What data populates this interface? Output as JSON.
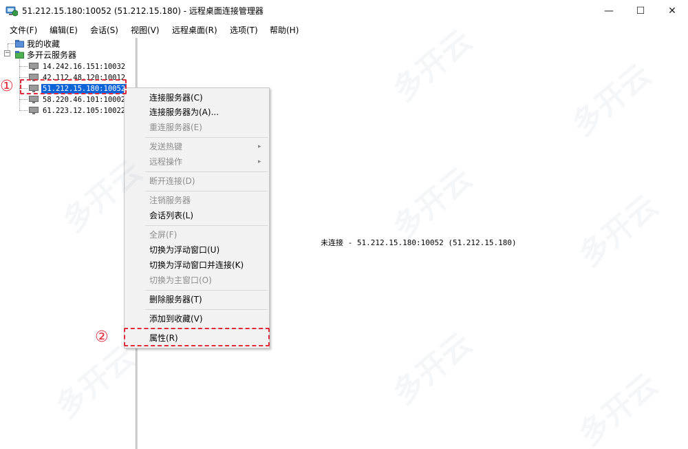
{
  "window": {
    "title": "51.212.15.180:10052 (51.212.15.180) - 远程桌面连接管理器",
    "min_glyph": "—",
    "max_glyph": "☐",
    "close_glyph": "✕"
  },
  "menu": [
    "文件(F)",
    "编辑(E)",
    "会话(S)",
    "视图(V)",
    "远程桌面(R)",
    "选项(T)",
    "帮助(H)"
  ],
  "tree": {
    "favorites": "我的收藏",
    "group": "多开云服务器",
    "expander": "−",
    "servers": [
      "14.242.16.151:10032",
      "42.112.48.120:10012",
      "51.212.15.180:10052",
      "58.220.46.101:10002",
      "61.223.12.105:10022"
    ]
  },
  "status": "未连接 - 51.212.15.180:10052 (51.212.15.180)",
  "context_menu": {
    "items": [
      {
        "label": "连接服务器(C)",
        "enabled": true
      },
      {
        "label": "连接服务器为(A)...",
        "enabled": true
      },
      {
        "label": "重连服务器(E)",
        "enabled": false
      },
      {
        "label": "发送热键",
        "enabled": false,
        "submenu": true
      },
      {
        "label": "远程操作",
        "enabled": false,
        "submenu": true
      },
      {
        "label": "断开连接(D)",
        "enabled": false
      },
      {
        "label": "注销服务器",
        "enabled": false
      },
      {
        "label": "会话列表(L)",
        "enabled": true
      },
      {
        "label": "全屏(F)",
        "enabled": false
      },
      {
        "label": "切换为浮动窗口(U)",
        "enabled": true
      },
      {
        "label": "切换为浮动窗口并连接(K)",
        "enabled": true
      },
      {
        "label": "切换为主窗口(O)",
        "enabled": false
      },
      {
        "label": "删除服务器(T)",
        "enabled": true
      },
      {
        "label": "添加到收藏(V)",
        "enabled": true
      },
      {
        "label": "属性(R)",
        "enabled": true
      }
    ],
    "submenu_arrow": "▸"
  },
  "annotations": {
    "step1": "①",
    "step2": "②",
    "color": "#e02a3a"
  },
  "watermark": "多开云",
  "colors": {
    "selection": "#0a64d8",
    "disabled_text": "#8d8d8d"
  }
}
